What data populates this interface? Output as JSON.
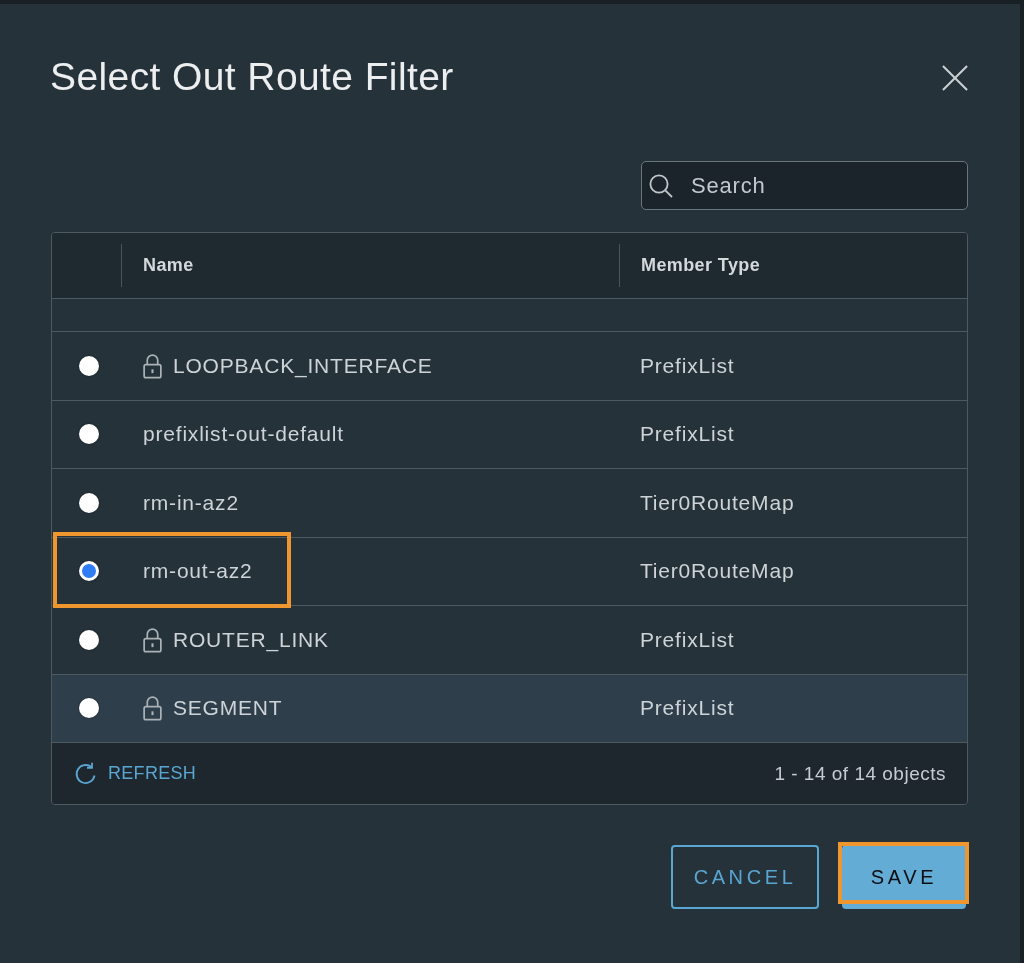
{
  "dialog": {
    "title": "Select Out Route Filter"
  },
  "search": {
    "placeholder": "Search"
  },
  "table": {
    "columns": [
      "Name",
      "Member Type"
    ],
    "rows": [
      {
        "name": "LOOPBACK_INTERFACE",
        "locked": true,
        "member_type": "PrefixList",
        "selected": false,
        "highlighted": false,
        "callout": false
      },
      {
        "name": "prefixlist-out-default",
        "locked": false,
        "member_type": "PrefixList",
        "selected": false,
        "highlighted": false,
        "callout": false
      },
      {
        "name": "rm-in-az2",
        "locked": false,
        "member_type": "Tier0RouteMap",
        "selected": false,
        "highlighted": false,
        "callout": false
      },
      {
        "name": "rm-out-az2",
        "locked": false,
        "member_type": "Tier0RouteMap",
        "selected": true,
        "highlighted": false,
        "callout": true
      },
      {
        "name": "ROUTER_LINK",
        "locked": true,
        "member_type": "PrefixList",
        "selected": false,
        "highlighted": false,
        "callout": false
      },
      {
        "name": "SEGMENT",
        "locked": true,
        "member_type": "PrefixList",
        "selected": false,
        "highlighted": true,
        "callout": false
      }
    ],
    "footer": {
      "refresh": "REFRESH",
      "count": "1 - 14 of 14 objects"
    }
  },
  "buttons": [
    {
      "label": "CANCEL",
      "kind": "outline",
      "callout": false
    },
    {
      "label": "SAVE",
      "kind": "primary",
      "callout": true
    }
  ]
}
